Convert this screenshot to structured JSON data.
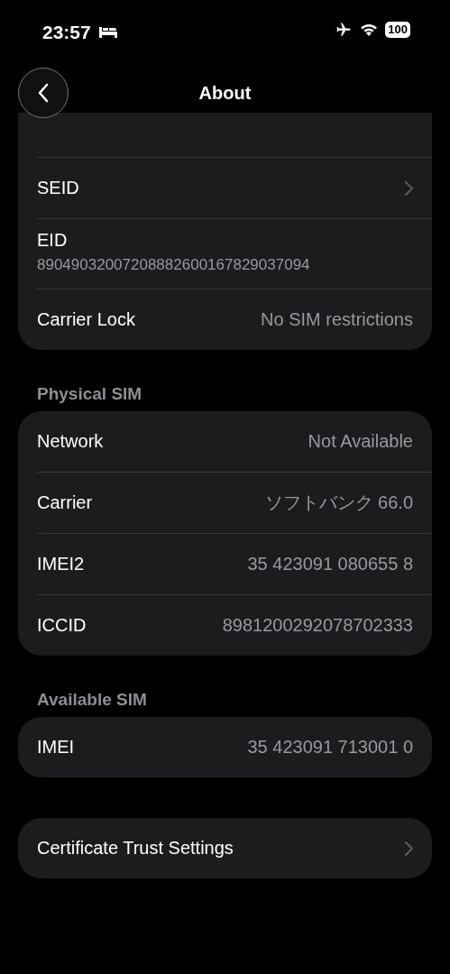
{
  "status_bar": {
    "time": "23:57",
    "battery": "100"
  },
  "nav": {
    "title": "About"
  },
  "sections": [
    {
      "cut_top": true,
      "rows": [
        {
          "kind": "link",
          "label": "SEID"
        },
        {
          "kind": "stacked",
          "label": "EID",
          "value": "89049032007208882600167829037094"
        },
        {
          "kind": "value",
          "label": "Carrier Lock",
          "value": "No SIM restrictions"
        }
      ]
    },
    {
      "header": "Physical SIM",
      "rows": [
        {
          "kind": "value",
          "label": "Network",
          "value": "Not Available"
        },
        {
          "kind": "value",
          "label": "Carrier",
          "value": "ソフトバンク 66.0"
        },
        {
          "kind": "value",
          "label": "IMEI2",
          "value": "35 423091 080655 8"
        },
        {
          "kind": "value",
          "label": "ICCID",
          "value": "8981200292078702333"
        }
      ]
    },
    {
      "header": "Available SIM",
      "rows": [
        {
          "kind": "value",
          "label": "IMEI",
          "value": "35 423091 713001 0"
        }
      ]
    },
    {
      "rows": [
        {
          "kind": "link",
          "label": "Certificate Trust Settings"
        }
      ]
    }
  ]
}
